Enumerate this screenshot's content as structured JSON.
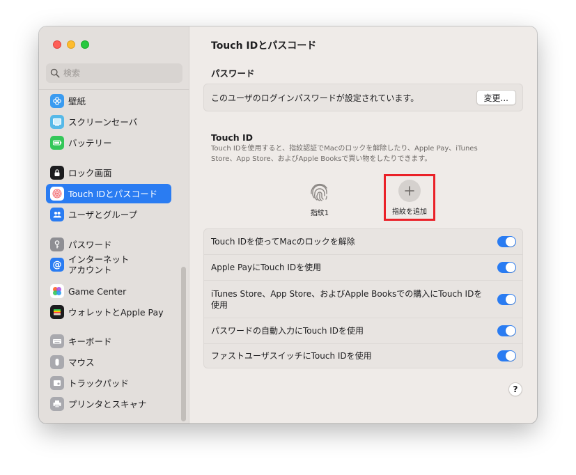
{
  "search": {
    "placeholder": "検索"
  },
  "sidebar": {
    "items": [
      {
        "label": "壁紙",
        "icon": "wallpaper-icon"
      },
      {
        "label": "スクリーンセーバ",
        "icon": "screensaver-icon"
      },
      {
        "label": "バッテリー",
        "icon": "battery-icon"
      },
      {
        "label": "ロック画面",
        "icon": "lock-icon"
      },
      {
        "label": "Touch IDとパスコード",
        "icon": "fingerprint-icon",
        "active": true
      },
      {
        "label": "ユーザとグループ",
        "icon": "users-icon"
      },
      {
        "label": "パスワード",
        "icon": "key-icon"
      },
      {
        "label": "インターネット\nアカウント",
        "icon": "at-icon"
      },
      {
        "label": "Game Center",
        "icon": "game-center-icon"
      },
      {
        "label": "ウォレットとApple Pay",
        "icon": "wallet-icon"
      },
      {
        "label": "キーボード",
        "icon": "keyboard-icon"
      },
      {
        "label": "マウス",
        "icon": "mouse-icon"
      },
      {
        "label": "トラックパッド",
        "icon": "trackpad-icon"
      },
      {
        "label": "プリンタとスキャナ",
        "icon": "printer-icon"
      }
    ]
  },
  "main": {
    "title": "Touch IDとパスコード",
    "password": {
      "heading": "パスワード",
      "text": "このユーザのログインパスワードが設定されています。",
      "button": "変更..."
    },
    "touchid": {
      "heading": "Touch ID",
      "description": "Touch IDを使用すると、指紋認証でMacのロックを解除したり、Apple Pay、iTunes Store、App Store、およびApple Booksで買い物をしたりできます。",
      "fingerprint_label": "指紋1",
      "add_label": "指紋を追加"
    },
    "toggles": [
      {
        "label": "Touch IDを使ってMacのロックを解除",
        "on": true
      },
      {
        "label": "Apple PayにTouch IDを使用",
        "on": true
      },
      {
        "label": "iTunes Store、App Store、およびApple Booksでの購入にTouch IDを使用",
        "on": true
      },
      {
        "label": "パスワードの自動入力にTouch IDを使用",
        "on": true
      },
      {
        "label": "ファストユーザスイッチにTouch IDを使用",
        "on": true
      }
    ],
    "help": "?"
  },
  "colors": {
    "accent": "#2a7cf2",
    "highlight": "#ea2128"
  }
}
